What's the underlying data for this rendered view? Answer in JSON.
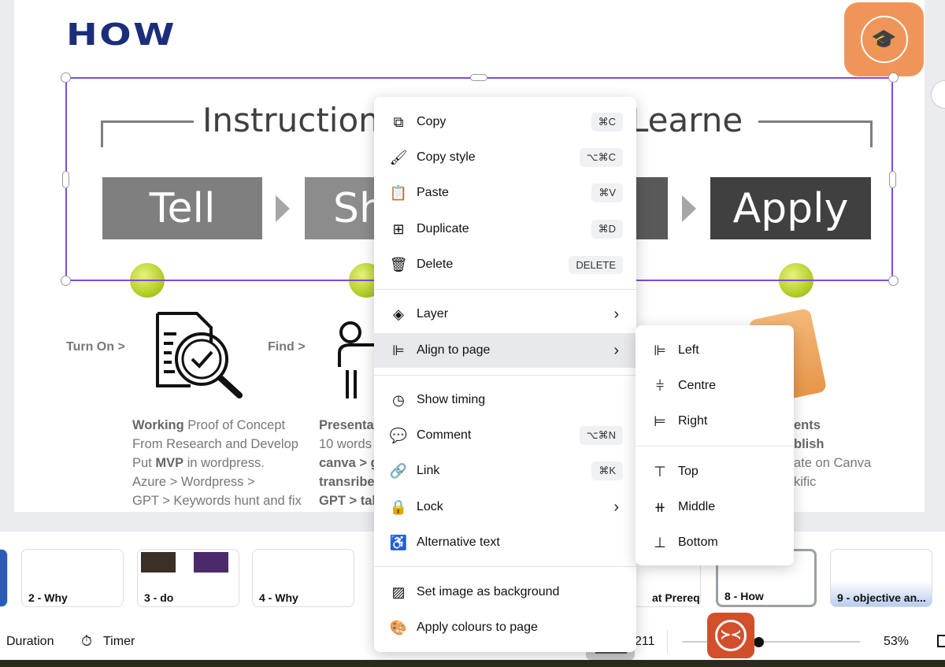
{
  "slide": {
    "title": "HOW",
    "diagram": {
      "left_heading": "Instruction",
      "right_heading": "Learner",
      "steps": [
        "Tell",
        "Sh",
        "Apply"
      ]
    },
    "labels": [
      "Turn On >",
      "Find >"
    ],
    "col1": [
      {
        "b": "Working",
        "t": " Proof of Concept"
      },
      {
        "b": "",
        "t": "From Research and Develop"
      },
      {
        "pre": "Put ",
        "b": "MVP",
        "t": " in wordpress."
      },
      {
        "b": "",
        "t": "Azure > Wordpress >"
      },
      {
        "b": "",
        "t": "GPT > Keywords hunt and fix"
      }
    ],
    "col2": [
      "Presenta",
      "10 words",
      "canva > g",
      "transribe",
      "GPT > tal"
    ],
    "col3": [
      "ents",
      "blish",
      "ate on Canva",
      "kific"
    ]
  },
  "context_menu": {
    "items": [
      {
        "label": "Copy",
        "shortcut": "⌘C",
        "icon": "copy-icon"
      },
      {
        "label": "Copy style",
        "shortcut": "⌥⌘C",
        "icon": "paint-roller-icon"
      },
      {
        "label": "Paste",
        "shortcut": "⌘V",
        "icon": "clipboard-icon"
      },
      {
        "label": "Duplicate",
        "shortcut": "⌘D",
        "icon": "duplicate-icon"
      },
      {
        "label": "Delete",
        "shortcut": "DELETE",
        "icon": "trash-icon"
      },
      {
        "label": "Layer",
        "icon": "layers-icon"
      },
      {
        "label": "Align to page",
        "icon": "align-left-icon"
      },
      {
        "label": "Show timing",
        "icon": "clock-icon"
      },
      {
        "label": "Comment",
        "shortcut": "⌥⌘N",
        "icon": "comment-icon"
      },
      {
        "label": "Link",
        "shortcut": "⌘K",
        "icon": "link-icon"
      },
      {
        "label": "Lock",
        "icon": "lock-icon"
      },
      {
        "label": "Alternative text",
        "icon": "accessibility-icon"
      },
      {
        "label": "Set image as background",
        "icon": "hatch-icon"
      },
      {
        "label": "Apply colours to page",
        "icon": "palette-icon"
      }
    ]
  },
  "align_submenu": {
    "items": [
      "Left",
      "Centre",
      "Right",
      "Top",
      "Middle",
      "Bottom"
    ]
  },
  "pages": [
    {
      "label": "2 - Why"
    },
    {
      "label": "3 - do"
    },
    {
      "label": "4 - Why"
    },
    {
      "label": "at Prereq..."
    },
    {
      "label": "8 - How",
      "selected": true
    },
    {
      "label": "9 - objective an..."
    }
  ],
  "footer": {
    "duration": "Duration",
    "timer": "Timer",
    "page_count": "211",
    "zoom": "53%",
    "zoom_fraction": 0.53
  },
  "colors": {
    "accent": "#7d4be0",
    "title": "#1c2e7a",
    "logo": "#f0955a"
  }
}
